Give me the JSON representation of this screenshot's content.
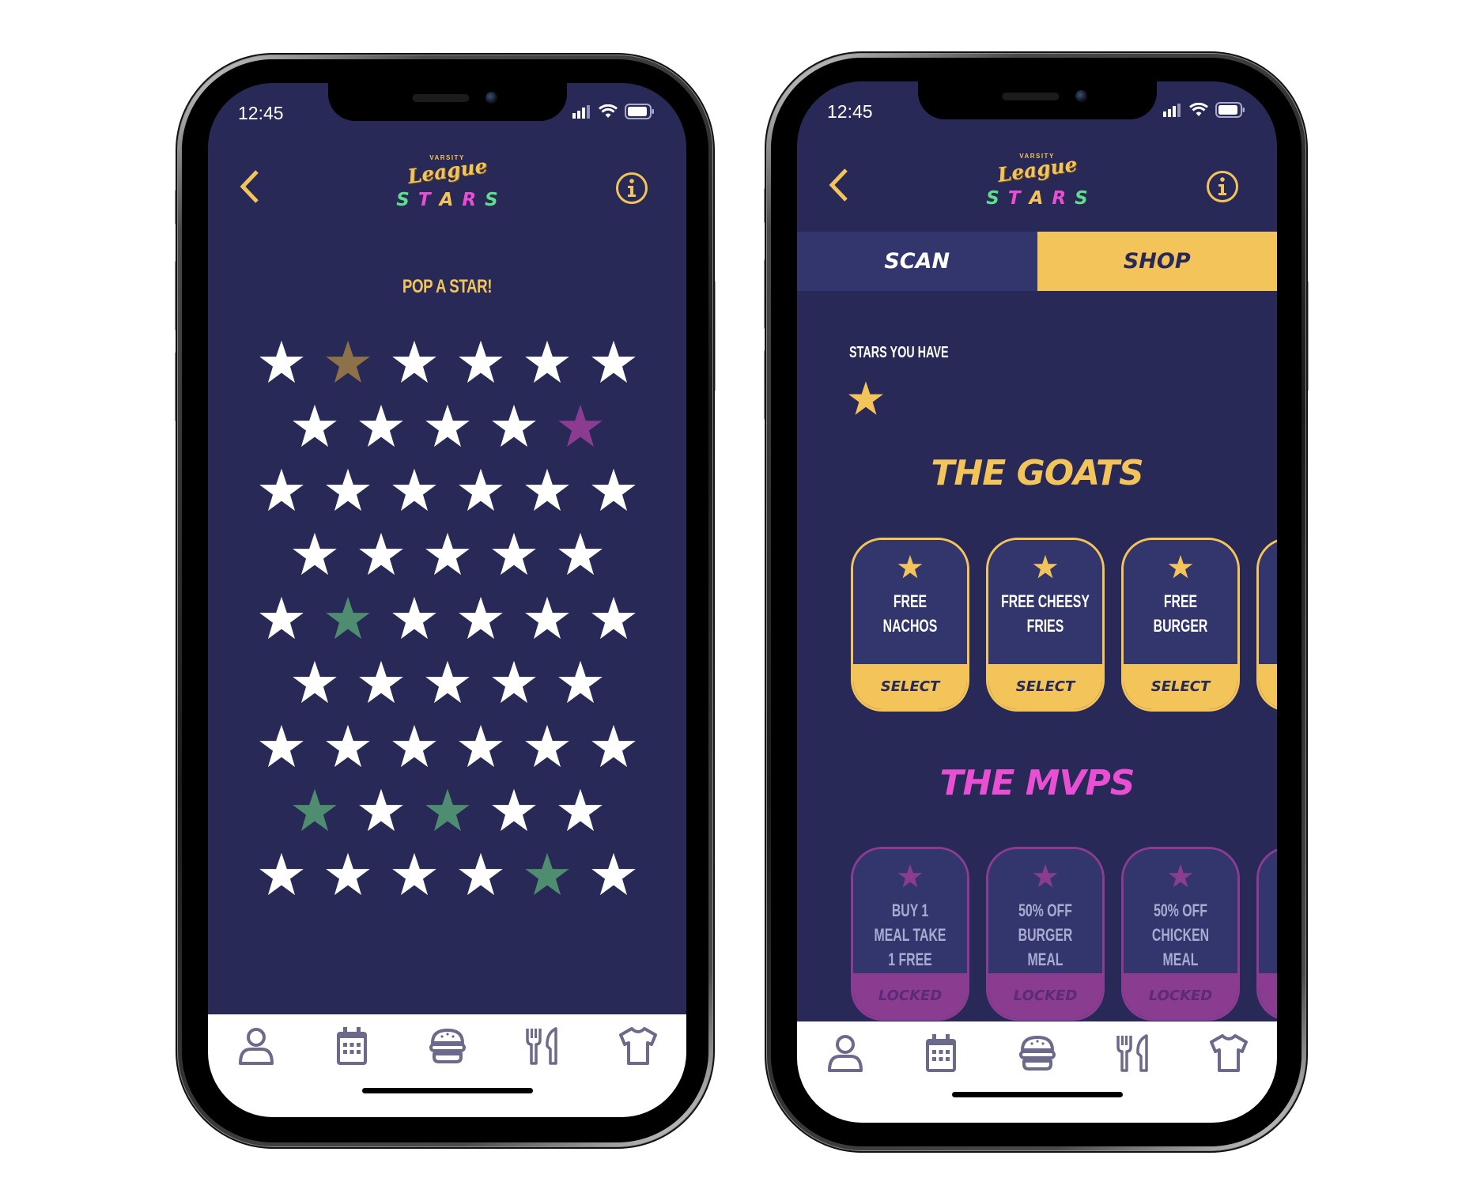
{
  "colors": {
    "background": "#282957",
    "panel": "#33366d",
    "accent_yellow": "#f3c45a",
    "accent_pink": "#e84fd2",
    "accent_green": "#5fdc8c",
    "locked_purple": "#8a3c91",
    "icon_gray": "#6b6a8c"
  },
  "status_bar": {
    "time": "12:45",
    "icons": [
      "signal-icon",
      "wifi-icon",
      "battery-icon"
    ]
  },
  "header": {
    "logo_small": "VARSITY",
    "logo_script": "League",
    "title_letters": [
      {
        "char": "S",
        "color": "#5fdc8c"
      },
      {
        "char": "T",
        "color": "#e84fd2"
      },
      {
        "char": "A",
        "color": "#f3c45a"
      },
      {
        "char": "R",
        "color": "#e84fd2"
      },
      {
        "char": "S",
        "color": "#5fdc8c"
      }
    ],
    "back_icon": "chevron-left-icon",
    "info_icon": "info-icon"
  },
  "left_screen": {
    "title": "POP A STAR!",
    "star_rows": [
      [
        "white",
        "gold",
        "white",
        "white",
        "white",
        "white"
      ],
      [
        "white",
        "white",
        "white",
        "white",
        "purple"
      ],
      [
        "white",
        "white",
        "white",
        "white",
        "white",
        "white"
      ],
      [
        "white",
        "white",
        "white",
        "white",
        "white"
      ],
      [
        "white",
        "green",
        "white",
        "white",
        "white",
        "white"
      ],
      [
        "white",
        "white",
        "white",
        "white",
        "white"
      ],
      [
        "white",
        "white",
        "white",
        "white",
        "white",
        "white"
      ],
      [
        "green",
        "white",
        "green",
        "white",
        "white"
      ],
      [
        "white",
        "white",
        "white",
        "white",
        "green",
        "white"
      ]
    ],
    "star_colors": {
      "white": "#ffffff",
      "gold": "#8c7149",
      "purple": "#8a3c91",
      "green": "#4e8d6f"
    }
  },
  "right_screen": {
    "tabs": [
      {
        "label": "SCAN",
        "active": false
      },
      {
        "label": "SHOP",
        "active": true
      }
    ],
    "stars_you_have_label": "STARS YOU HAVE",
    "stars_you_have_count": 1,
    "sections": [
      {
        "title": "THE GOATS",
        "title_color": "#f3c45a",
        "cards": [
          {
            "label": "FREE\nNACHOS",
            "action": "SELECT"
          },
          {
            "label": "FREE CHEESY\nFRIES",
            "action": "SELECT"
          },
          {
            "label": "FREE\nBURGER",
            "action": "SELECT"
          }
        ]
      },
      {
        "title": "THE MVPS",
        "title_color": "#e84fd2",
        "cards": [
          {
            "label": "BUY 1\nMEAL TAKE\n1 FREE",
            "action": "LOCKED"
          },
          {
            "label": "50% OFF\nBURGER\nMEAL",
            "action": "LOCKED"
          },
          {
            "label": "50% OFF\nCHICKEN\nMEAL",
            "action": "LOCKED"
          }
        ]
      }
    ]
  },
  "tab_bar": {
    "items": [
      {
        "name": "profile",
        "icon": "user-icon"
      },
      {
        "name": "calendar",
        "icon": "calendar-icon"
      },
      {
        "name": "food",
        "icon": "burger-icon"
      },
      {
        "name": "dining",
        "icon": "fork-knife-icon"
      },
      {
        "name": "merch",
        "icon": "tshirt-icon"
      }
    ]
  }
}
